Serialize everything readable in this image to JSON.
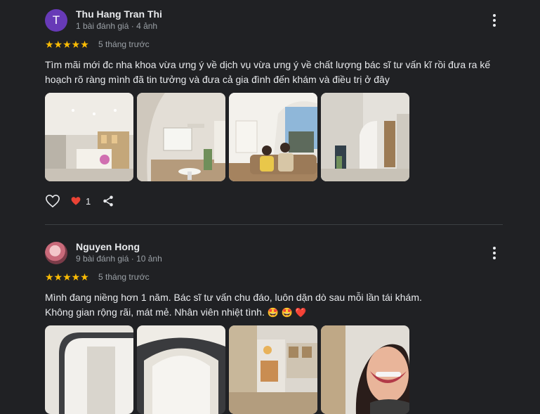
{
  "reviews": [
    {
      "avatar_letter": "T",
      "name": "Thu Hang Tran Thi",
      "meta": "1 bài đánh giá · 4 ảnh",
      "stars": "★★★★★",
      "date": "5 tháng trước",
      "text": "Tìm mãi mới đc nha khoa vừa ưng ý về dịch vụ vừa ưng ý về chất lượng bác sĩ tư vấn kĩ rồi đưa ra kế hoạch rõ ràng mình đã tin tưởng và đưa cả gia đình đến khám và điều trị ở đây",
      "likes": "1"
    },
    {
      "name": "Nguyen Hong",
      "meta": "9 bài đánh giá · 10 ảnh",
      "stars": "★★★★★",
      "date": "5 tháng trước",
      "text_line1": "Mình đang niềng hơn 1 năm. Bác sĩ tư vấn chu đáo, luôn dặn dò sau mỗi lần tái khám.",
      "text_line2": "Không gian rộng rãi, mát mẻ. Nhân viên nhiệt tình.",
      "emojis": "🤩 🤩 ❤️"
    }
  ],
  "colors": {
    "background": "#202124",
    "star": "#fbbc04",
    "avatar": "#673ab7",
    "heart": "#ea4335"
  },
  "icons": [
    "like-icon",
    "heart-icon",
    "share-icon",
    "more-icon"
  ]
}
